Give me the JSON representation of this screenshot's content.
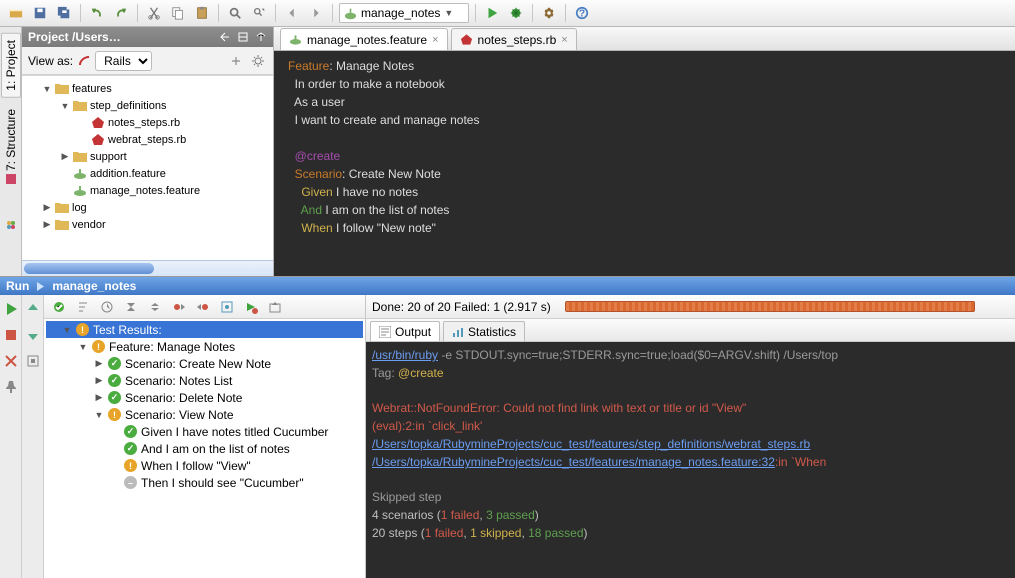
{
  "toolbar": {
    "run_config": "manage_notes"
  },
  "lefttabs": {
    "project": "1: Project",
    "structure": "7: Structure"
  },
  "project": {
    "title": "Project /Users…",
    "viewas_label": "View as:",
    "viewas_value": "Rails",
    "tree": {
      "features": "features",
      "step_definitions": "step_definitions",
      "notes_steps": "notes_steps.rb",
      "webrat_steps": "webrat_steps.rb",
      "support": "support",
      "addition": "addition.feature",
      "manage_notes": "manage_notes.feature",
      "log": "log",
      "vendor": "vendor"
    }
  },
  "editor": {
    "tabs": [
      {
        "label": "manage_notes.feature",
        "icon": "feature"
      },
      {
        "label": "notes_steps.rb",
        "icon": "ruby"
      }
    ],
    "code": {
      "l1a": "Feature",
      "l1b": ": Manage Notes",
      "l2": "  In order to make a notebook",
      "l3": "  As a user",
      "l4": "  I want to create and manage notes",
      "l6": "  @create",
      "l7a": "  Scenario",
      "l7b": ": Create New Note",
      "l8a": "    Given",
      "l8b": " I have no notes",
      "l9a": "    And",
      "l9b": " I am on the list of notes",
      "l10a": "    When",
      "l10b": " I follow \"New note\""
    }
  },
  "run": {
    "title_prefix": "Run",
    "title": "manage_notes",
    "done": "Done: 20 of 20  Failed: 1  (2.917 s)",
    "tree": {
      "root": "Test Results:",
      "feature": "Feature: Manage Notes",
      "s1": "Scenario: Create New Note",
      "s2": "Scenario: Notes List",
      "s3": "Scenario: Delete Note",
      "s4": "Scenario: View Note",
      "s4a": "Given I have notes titled Cucumber",
      "s4b": "And I am on the list of notes",
      "s4c": "When I follow \"View\"",
      "s4d": "Then I should see \"Cucumber\""
    },
    "out_tabs": {
      "output": "Output",
      "statistics": "Statistics"
    },
    "console": {
      "l1a": "/usr/bin/ruby",
      "l1b": " -e STDOUT.sync=true;STDERR.sync=true;load($0=ARGV.shift) /Users/top",
      "l2a": "Tag: ",
      "l2b": "@create",
      "l4": "Webrat::NotFoundError: Could not find link with text or title or id \"View\"",
      "l5": "(eval):2:in `click_link'",
      "l6": "/Users/topka/RubymineProjects/cuc_test/features/step_definitions/webrat_steps.rb",
      "l7a": "/Users/topka/RubymineProjects/cuc_test/features/manage_notes.feature:32",
      "l7b": ":in `When ",
      "l9": "Skipped step",
      "l10a": "4 scenarios (",
      "l10b": "1 failed",
      "l10c": ", ",
      "l10d": "3 passed",
      "l10e": ")",
      "l11a": "20 steps (",
      "l11b": "1 failed",
      "l11c": ", ",
      "l11d": "1 skipped",
      "l11e": ", ",
      "l11f": "18 passed",
      "l11g": ")"
    }
  }
}
